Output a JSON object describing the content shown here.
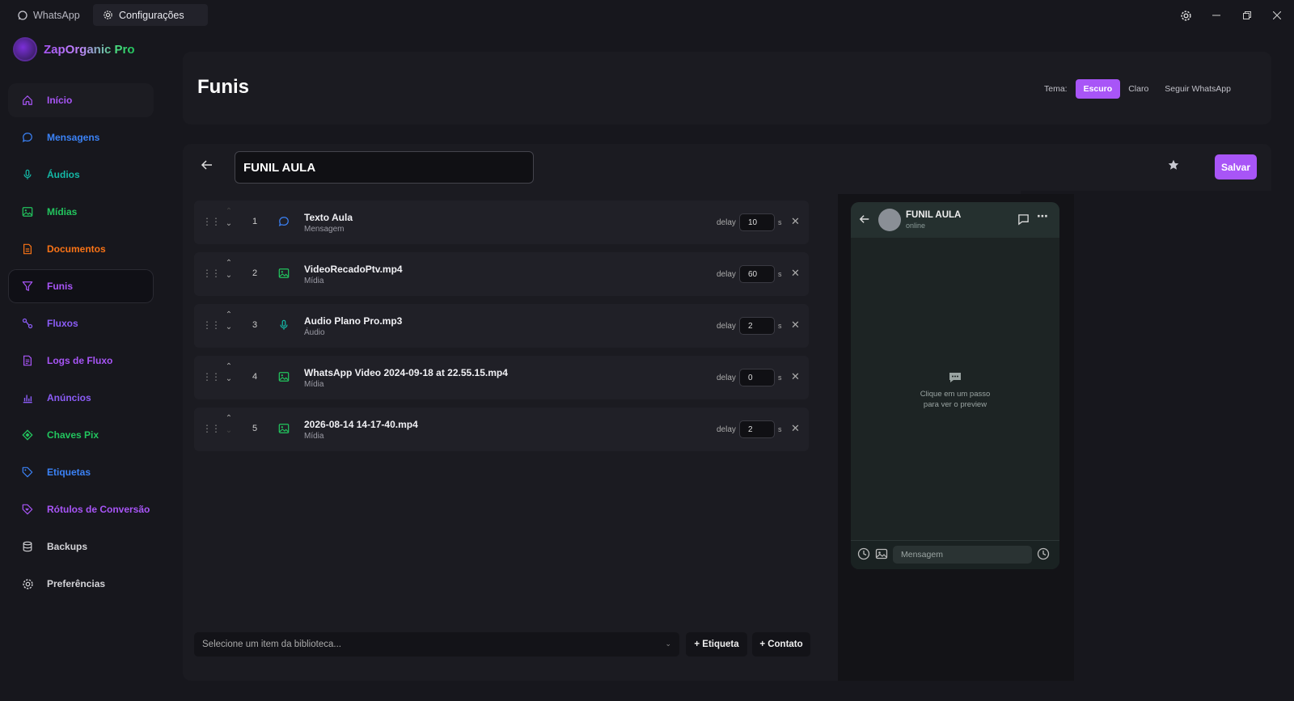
{
  "titlebar": {
    "tabs": [
      {
        "label": "WhatsApp",
        "icon": "whatsapp-icon"
      },
      {
        "label": "Configurações",
        "icon": "gear-icon"
      }
    ]
  },
  "brand": {
    "name": "ZapOrganic Pro"
  },
  "sidebar": {
    "items": [
      {
        "label": "Início",
        "icon": "home-icon",
        "color": "#a855f7"
      },
      {
        "label": "Mensagens",
        "icon": "chat-bubble-icon",
        "color": "#3b82f6"
      },
      {
        "label": "Áudios",
        "icon": "microphone-icon",
        "color": "#14b8a6"
      },
      {
        "label": "Mídias",
        "icon": "image-icon",
        "color": "#22c55e"
      },
      {
        "label": "Documentos",
        "icon": "document-icon",
        "color": "#f97316"
      },
      {
        "label": "Funis",
        "icon": "funnel-icon",
        "color": "#a855f7"
      },
      {
        "label": "Fluxos",
        "icon": "flow-icon",
        "color": "#8b5cf6"
      },
      {
        "label": "Logs de Fluxo",
        "icon": "log-icon",
        "color": "#a855f7"
      },
      {
        "label": "Anúncios",
        "icon": "bar-chart-icon",
        "color": "#8b5cf6"
      },
      {
        "label": "Chaves Pix",
        "icon": "pix-icon",
        "color": "#22c55e"
      },
      {
        "label": "Etiquetas",
        "icon": "tag-icon",
        "color": "#3b82f6"
      },
      {
        "label": "Rótulos de Conversão",
        "icon": "tag-heart-icon",
        "color": "#a855f7"
      },
      {
        "label": "Backups",
        "icon": "database-icon",
        "color": "#d4d4d8"
      },
      {
        "label": "Preferências",
        "icon": "settings-icon",
        "color": "#d4d4d8"
      }
    ]
  },
  "header": {
    "title": "Funis",
    "theme_label": "Tema:",
    "theme_options": [
      "Escuro",
      "Claro",
      "Seguir WhatsApp"
    ],
    "theme_selected": "Escuro"
  },
  "editor": {
    "funnel_name": "FUNIL AULA",
    "save_label": "Salvar",
    "delay_label": "delay",
    "delay_unit": "s",
    "steps": [
      {
        "num": "1",
        "title": "Texto Aula",
        "type": "Mensagem",
        "icon": "chat-bubble-icon",
        "delay": "10"
      },
      {
        "num": "2",
        "title": "VideoRecadoPtv.mp4",
        "type": "Mídia",
        "icon": "image-icon",
        "delay": "60"
      },
      {
        "num": "3",
        "title": "Audio Plano Pro.mp3",
        "type": "Áudio",
        "icon": "microphone-icon",
        "delay": "2"
      },
      {
        "num": "4",
        "title": "WhatsApp Video 2024-09-18 at 22.55.15.mp4",
        "type": "Mídia",
        "icon": "image-icon",
        "delay": "0"
      },
      {
        "num": "5",
        "title": "2026-08-14 14-17-40.mp4",
        "type": "Mídia",
        "icon": "image-icon",
        "delay": "2"
      }
    ],
    "library_placeholder": "Selecione um item da biblioteca...",
    "add_tag_label": "+ Etiqueta",
    "add_contact_label": "+ Contato"
  },
  "preview": {
    "contact_name": "FUNIL AULA",
    "status": "online",
    "empty_line1": "Clique em um passo",
    "empty_line2": "para ver o preview",
    "message_placeholder": "Mensagem"
  },
  "colors": {
    "accent": "#a855f7",
    "background": "#17171d",
    "panel": "#1b1b21"
  }
}
